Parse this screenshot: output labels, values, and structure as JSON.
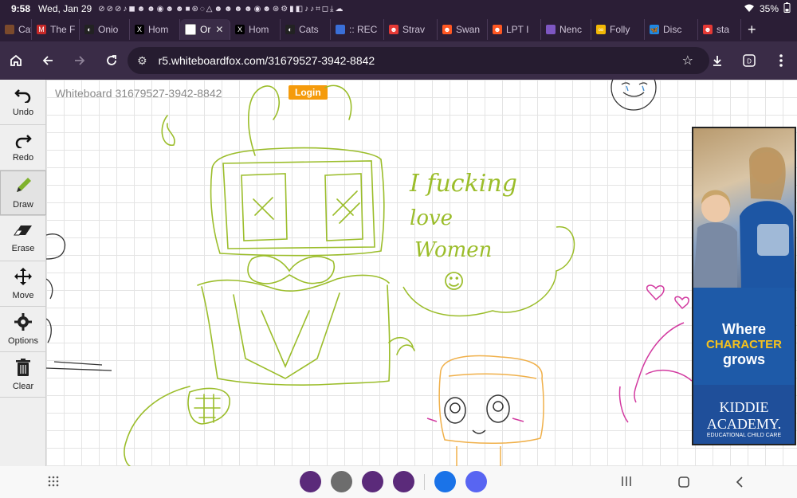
{
  "status": {
    "time": "9:58",
    "date": "Wed, Jan 29",
    "notifications": "⊘⊘⊘♪◼☻☻◉☻☻■⊛◌△☻☻☻☻◉☻⊛⚙▮◧♪♪⌗◻⤓☁",
    "battery": "35%"
  },
  "tabs": [
    {
      "label": "Cats",
      "fav_color": "#7b4a2c",
      "fav": ""
    },
    {
      "label": "The F",
      "fav_color": "#c62828",
      "fav": "M"
    },
    {
      "label": "Onio",
      "fav_color": "#222222",
      "fav": "◐"
    },
    {
      "label": "Hom",
      "fav_color": "#000000",
      "fav": "X"
    },
    {
      "label": "Or",
      "fav_color": "#ffffff",
      "fav": "",
      "active": true
    },
    {
      "label": "Hom",
      "fav_color": "#000000",
      "fav": "X"
    },
    {
      "label": "Cats",
      "fav_color": "#222222",
      "fav": "◐"
    },
    {
      "label": ":: REC",
      "fav_color": "#3a6fd8",
      "fav": ""
    },
    {
      "label": "Strav",
      "fav_color": "#e53935",
      "fav": "☻"
    },
    {
      "label": "Swan",
      "fav_color": "#ff5722",
      "fav": "☻"
    },
    {
      "label": "LPT I",
      "fav_color": "#ff5722",
      "fav": "☻"
    },
    {
      "label": "Nenc",
      "fav_color": "#7e57c2",
      "fav": ""
    },
    {
      "label": "Folly",
      "fav_color": "#f2b705",
      "fav": "∞"
    },
    {
      "label": "Disc",
      "fav_color": "#1e88e5",
      "fav": "🦋"
    },
    {
      "label": "sta",
      "fav_color": "#e53935",
      "fav": "☻"
    }
  ],
  "toolbar": {
    "url": "r5.whiteboardfox.com/31679527-3942-8842",
    "icons": [
      "home-icon",
      "back-icon",
      "forward-icon",
      "reload-icon",
      "star-icon",
      "download-icon",
      "dex-icon",
      "menu-icon"
    ]
  },
  "whiteboard": {
    "title": "Whiteboard 31679527-3942-8842",
    "login_label": "Login",
    "handwriting": [
      "I fucking",
      "love",
      "Women",
      "☺"
    ]
  },
  "tools": [
    {
      "label": "Undo",
      "icon": "undo-icon"
    },
    {
      "label": "Redo",
      "icon": "redo-icon"
    },
    {
      "label": "Draw",
      "icon": "pencil-icon",
      "active": true
    },
    {
      "label": "Erase",
      "icon": "eraser-icon"
    },
    {
      "label": "Move",
      "icon": "move-icon"
    },
    {
      "label": "Options",
      "icon": "gear-icon"
    },
    {
      "label": "Clear",
      "icon": "trash-icon"
    }
  ],
  "ad": {
    "line1": "Where",
    "line2": "CHARACTER",
    "line3": "grows",
    "brand1": "KIDDIE",
    "brand2": "ACADEMY.",
    "brand3": "EDUCATIONAL CHILD CARE"
  },
  "dock": [
    {
      "icon": "notes-app-icon",
      "color": "#5b2a7a"
    },
    {
      "icon": "robot-app-icon",
      "color": "#6d6d6d"
    },
    {
      "icon": "browser-app-icon",
      "color": "#5b2a7a"
    },
    {
      "icon": "flower-app-icon",
      "color": "#5b2a7a"
    },
    {
      "icon": "ibispaint-app-icon",
      "color": "#1a73e8"
    },
    {
      "icon": "discord-app-icon",
      "color": "#5865f2"
    }
  ]
}
